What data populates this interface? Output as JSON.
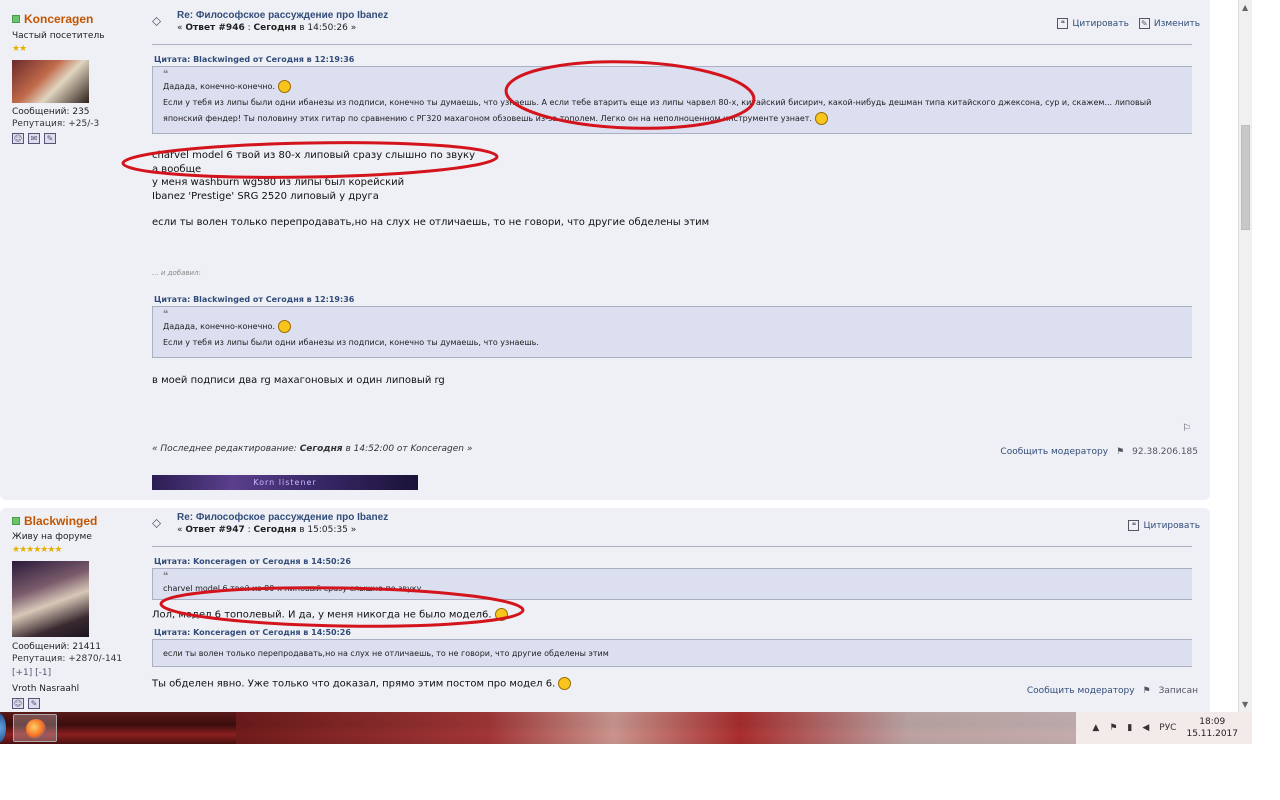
{
  "posts": [
    {
      "author": "Konceragen",
      "rank": "Частый посетитель",
      "stars": "★★",
      "messages": "Сообщений: 235",
      "reputation": "Репутация: +25/-3",
      "subject": "Re: Философское рассуждение про Ibanez",
      "reply_label": "Ответ #946",
      "date": "Сегодня",
      "time_prefix": "в",
      "time": "14:50:26",
      "actions": {
        "quote": "Цитировать",
        "edit": "Изменить"
      },
      "quote1": {
        "header": "Цитата: Blackwinged от Сегодня в 12:19:36",
        "line1": "Дадада, конечно-конечно.",
        "line2": "Если у тебя из липы были одни ибанезы из подписи, конечно ты думаешь, что узнаешь. А если тебе втарить еще из липы чарвел 80-х, китайский бисирич, какой-нибудь дешман типа китайского джексона, сур и, скажем... липовый",
        "line3": "японский фендер! Ты половину этих гитар по сравнению с РГ320 махагоном обзовешь из-за тополем. Легко он на неполноценном инструменте узнает."
      },
      "body_lines": [
        "charvel model 6 твой из 80-х липовый сразу слышно по звуку",
        "а вообще",
        "у меня washburn wg580 из липы был корейский",
        "Ibanez 'Prestige' SRG 2520 липовый у друга"
      ],
      "body_line2": "если ты волен только перепродавать,но на слух не отличаешь, то не говори, что другие обделены этим",
      "added": "... и добавил:",
      "quote2": {
        "header": "Цитата: Blackwinged от Сегодня в 12:19:36",
        "line1": "Дадада, конечно-конечно.",
        "line2": "Если у тебя из липы были одни ибанезы из подписи, конечно ты думаешь, что узнаешь."
      },
      "body3": "в моей подписи два rg махагоновых и один липовый rg",
      "edited_prefix": "« Последнее редактирование:",
      "edited_date": "Сегодня",
      "edited_rest": "в 14:52:00 от Konceragen »",
      "report": "Сообщить модератору",
      "ip": "92.38.206.185",
      "banner_text": "Korn listener"
    },
    {
      "author": "Blackwinged",
      "rank": "Живу на форуме",
      "stars": "★★★★★★★",
      "messages": "Сообщений: 21411",
      "reputation": "Репутация: +2870/-141",
      "karma": "[+1] [-1]",
      "sig_name": "Vroth Nasraahl",
      "subject": "Re: Философское рассуждение про Ibanez",
      "reply_label": "Ответ #947",
      "date": "Сегодня",
      "time_prefix": "в",
      "time": "15:05:35",
      "actions": {
        "quote": "Цитировать"
      },
      "quote1": {
        "header": "Цитата: Konceragen от Сегодня в 14:50:26",
        "line1": "charvel model 6 твой из 80-х липовый сразу слышно по звуку"
      },
      "body1": "Лол, модел 6 тополевый. И да, у меня никогда не было модел6.",
      "quote2": {
        "header": "Цитата: Konceragen от Сегодня в 14:50:26",
        "line1": "если ты волен только перепродавать,но на слух не отличаешь, то не говори, что другие обделены этим"
      },
      "body2": "Ты обделен явно. Уже только что доказал, прямо этим постом про модел 6.",
      "report": "Сообщить модератору",
      "logged": "Записан"
    }
  ],
  "taskbar": {
    "lang": "РУС",
    "time": "18:09",
    "date": "15.11.2017"
  },
  "colors": {
    "annotation": "#d4141c",
    "link": "#334d7a",
    "username": "#c45500"
  }
}
